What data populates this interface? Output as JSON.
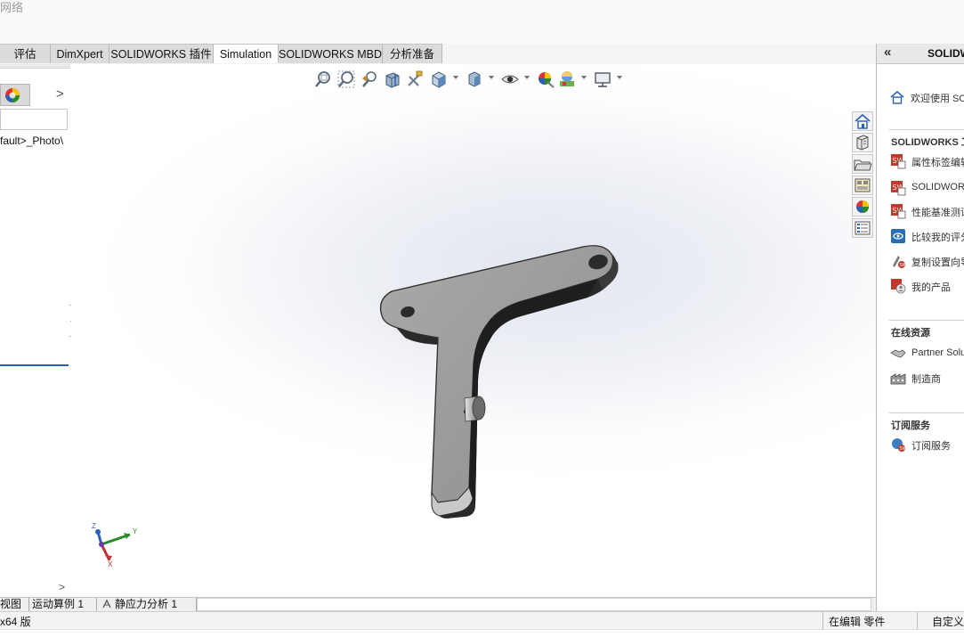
{
  "window": {
    "title_fragment": "网络"
  },
  "tabs": [
    {
      "label": "评估"
    },
    {
      "label": "DimXpert"
    },
    {
      "label": "SOLIDWORKS 插件"
    },
    {
      "label": "Simulation"
    },
    {
      "label": "SOLIDWORKS MBD"
    },
    {
      "label": "分析准备"
    }
  ],
  "left_panel": {
    "path_text": "fault>_Photo\\",
    "next_arrow": ">",
    "bottom_arrow": ">"
  },
  "viewport": {
    "hud_icons": [
      "zoom-to-fit-icon",
      "zoom-to-area-icon",
      "previous-view-icon",
      "section-view-icon",
      "dynamic-annotation-icon",
      "view-orientation-icon",
      "display-style-icon",
      "hide-show-items-icon",
      "edit-appearance-icon",
      "apply-scene-icon",
      "view-settings-icon"
    ],
    "window_controls": [
      "restore-left-icon",
      "restore-right-icon",
      "minimize-icon",
      "maximize-icon",
      "close-icon"
    ],
    "triad": {
      "x": "Y",
      "z": "Z",
      "neg": "X"
    }
  },
  "task_pane_tabs": [
    "home-icon",
    "design-library-icon",
    "file-explorer-icon",
    "view-palette-icon",
    "appearances-icon",
    "custom-properties-icon"
  ],
  "right_panel": {
    "header_collapse": "«",
    "header_title": "SOLIDW",
    "welcome": "欢迎使用 SO",
    "sections": [
      {
        "title": "SOLIDWORKS 工",
        "items": [
          "属性标签编辑",
          "SOLIDWOR",
          "性能基准测试",
          "比较我的评分",
          "复制设置向导",
          "我的产品"
        ]
      },
      {
        "title": "在线资源",
        "items": [
          "Partner Solu",
          "制造商"
        ]
      },
      {
        "title": "订阅服务",
        "items": [
          "订阅服务"
        ]
      }
    ]
  },
  "bottom_tabs": [
    {
      "label": "视图"
    },
    {
      "label": "运动算例 1"
    },
    {
      "label": "静应力分析 1"
    }
  ],
  "status": {
    "left": "x64 版",
    "editing": "在编辑 零件",
    "custom": "自定义"
  },
  "colors": {
    "accent_blue": "#2a5fb5",
    "part_gray": "#9a9a9a"
  }
}
